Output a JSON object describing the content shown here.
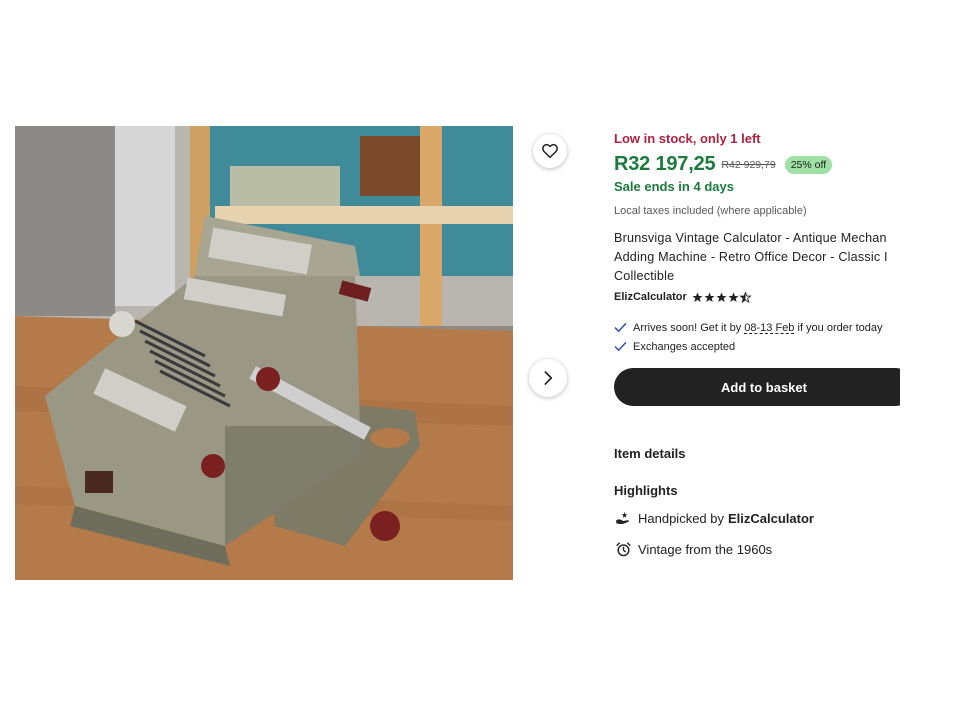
{
  "listing": {
    "stock_notice": "Low in stock, only 1 left",
    "price": "R32 197,25",
    "original_price": "R42 929,79",
    "discount_badge": "25% off",
    "sale_ends": "Sale ends in 4 days",
    "taxes_note": "Local taxes included (where applicable)",
    "title_lines": [
      "Brunsviga Vintage Calculator - Antique Mechan",
      "Adding Machine - Retro Office Decor - Classic I",
      "Collectible"
    ],
    "seller_name": "ElizCalculator",
    "rating_stars": 4.5
  },
  "shipping": {
    "arrives_prefix": "Arrives soon! Get it by",
    "arrives_dates": "08-13 Feb",
    "arrives_suffix": "if you order today",
    "exchanges": "Exchanges accepted"
  },
  "actions": {
    "add_to_basket": "Add to basket"
  },
  "details": {
    "item_details_label": "Item details",
    "highlights_label": "Highlights",
    "handpicked_prefix": "Handpicked by",
    "handpicked_seller": "ElizCalculator",
    "vintage_text": "Vintage from the 1960s"
  },
  "icons": {
    "favorite": "heart-icon",
    "next": "chevron-right-icon",
    "check": "check-icon",
    "handpicked": "hand-icon",
    "vintage": "alarm-clock-icon",
    "star": "star-icon"
  },
  "colors": {
    "stock_red": "#b3213f",
    "sale_green": "#1a7b3c",
    "badge_green": "#9fe0a5",
    "button_dark": "#222222"
  }
}
